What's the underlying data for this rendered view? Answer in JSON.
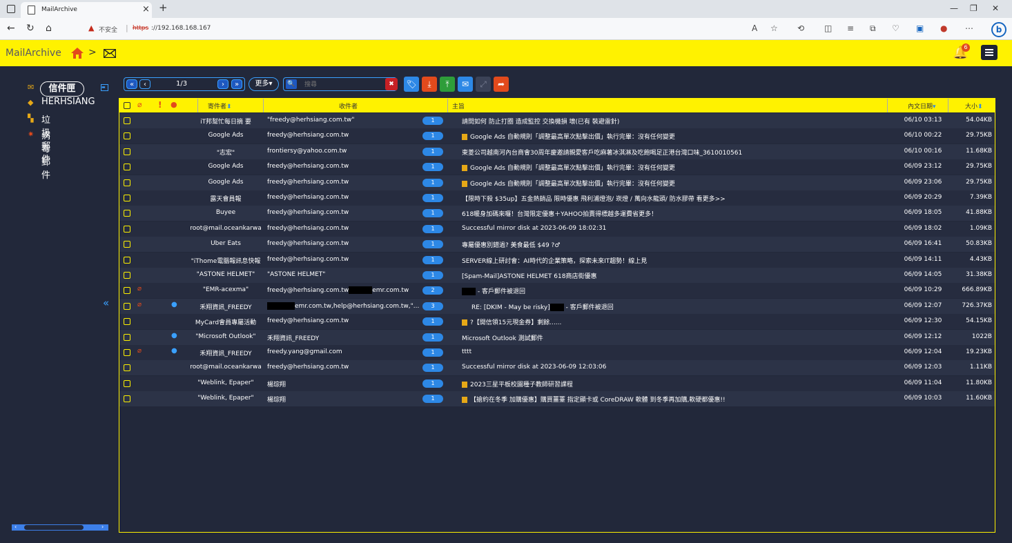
{
  "browser": {
    "tab_title": "MailArchive",
    "insecure_label": "不安全",
    "url_scheme": "https",
    "url_host": "://192.168.168.167"
  },
  "app": {
    "title": "MailArchive",
    "crumb_sep": ">",
    "notification_count": "6"
  },
  "sidebar": {
    "inbox_label": "信件匣",
    "items": [
      {
        "label": "HERHSIANG",
        "icon": "tag-icon"
      },
      {
        "label": "垃圾郵件",
        "icon": "trash-icon"
      },
      {
        "label": "病毒郵件",
        "icon": "virus-icon"
      }
    ]
  },
  "toolbar": {
    "first": "«",
    "prev": "‹",
    "page": "1/3",
    "next": "›",
    "last": "»",
    "more_label": "更多",
    "search_placeholder": "搜尋"
  },
  "grid": {
    "headers": {
      "sender": "寄件者",
      "recipient": "收件者",
      "subject": "主旨",
      "date": "內文日期",
      "size": "大小"
    },
    "rows": [
      {
        "sender": "iT邦幫忙每日摘 要",
        "recipient": "\"freedy@herhsiang.com.tw\"",
        "count": "1",
        "subject": "請問如何 防止打圈 造成監控 交換機損 壞(已有 裝避雷針)",
        "date": "06/10 03:13",
        "size": "54.04KB"
      },
      {
        "sender": "Google Ads",
        "recipient": "freedy@herhsiang.com.tw",
        "count": "1",
        "subject": "Google Ads 自動規則「調整最高單次點擊出價」執行完畢：沒有任何變更",
        "date": "06/10 00:22",
        "size": "29.75KB",
        "icon": true
      },
      {
        "sender": "\"志宏\"",
        "recipient": "frontiersy@yahoo.com.tw",
        "count": "1",
        "subject": "東菱公司越南河內台商會30周年慶邀請親愛客戶吃麻薯冰淇淋及吃飽喝足正港台灣口味_3610010561",
        "date": "06/10 00:16",
        "size": "11.68KB"
      },
      {
        "sender": "Google Ads",
        "recipient": "freedy@herhsiang.com.tw",
        "count": "1",
        "subject": "Google Ads 自動規則「調整最高單次點擊出價」執行完畢：沒有任何變更",
        "date": "06/09 23:12",
        "size": "29.75KB",
        "icon": true
      },
      {
        "sender": "Google Ads",
        "recipient": "freedy@herhsiang.com.tw",
        "count": "1",
        "subject": "Google Ads 自動規則「調整最高單次點擊出價」執行完畢：沒有任何變更",
        "date": "06/09 23:06",
        "size": "29.75KB",
        "icon": true
      },
      {
        "sender": "露天會員報",
        "recipient": "freedy@herhsiang.com.tw",
        "count": "1",
        "subject": "【限時下殺 $35up】五金熱銷品 限時優惠 飛利浦燈泡/ 崁燈 / 萬向水龍頭/ 防水膠帶 看更多>>",
        "date": "06/09 20:29",
        "size": "7.39KB"
      },
      {
        "sender": "Buyee",
        "recipient": "freedy@herhsiang.com.tw",
        "count": "1",
        "subject": "618暖身加碼來囉！台灣限定優惠＋YAHOO拍賣得標越多運費省更多！",
        "date": "06/09 18:05",
        "size": "41.88KB"
      },
      {
        "sender": "root@mail.oceankarwa",
        "recipient": "freedy@herhsiang.com.tw",
        "count": "1",
        "subject": "Successful mirror disk at 2023-06-09 18:02:31",
        "date": "06/09 18:02",
        "size": "1.09KB"
      },
      {
        "sender": "Uber Eats",
        "recipient": "freedy@herhsiang.com.tw",
        "count": "1",
        "subject": "專屬優惠別錯過? 美食最低 $49 ?♂",
        "date": "06/09 16:41",
        "size": "50.83KB"
      },
      {
        "sender": "\"iThome電腦報訊息快報",
        "recipient": "freedy@herhsiang.com.tw",
        "count": "1",
        "subject": "SERVER線上研討會：AI時代的企業策略，探索未來IT趨勢！線上見",
        "date": "06/09 14:11",
        "size": "4.43KB"
      },
      {
        "sender": "\"ASTONE HELMET\"",
        "recipient": "\"ASTONE HELMET\"",
        "count": "1",
        "subject": "[Spam-Mail]ASTONE HELMET  618商店街優惠",
        "date": "06/09 14:05",
        "size": "31.38KB"
      },
      {
        "sender": "\"EMR-acexma\"",
        "recipient": "freedy@herhsiang.com.tw",
        "recipient2": "emr.com.tw",
        "count": "2",
        "subject": " - 客戶郵件被退回",
        "date": "06/09 10:29",
        "size": "666.89KB",
        "clip": true,
        "redact_subject": true
      },
      {
        "sender": "禾翔資訊_FREEDY",
        "recipient": "emr.com.tw,help@herhsiang.com.tw,\"...",
        "count": "3",
        "subject": "RE: [DKIM - May be risky]",
        "subject2": " - 客戶郵件被退回",
        "date": "06/09 12:07",
        "size": "726.37KB",
        "clip": true,
        "person": true
      },
      {
        "sender": "MyCard會員專屬活動",
        "recipient": "freedy@herhsiang.com.tw",
        "count": "1",
        "subject": "?【開信領15元現金券】剩餘......",
        "date": "06/09 12:30",
        "size": "54.15KB",
        "icon": true
      },
      {
        "sender": "\"Microsoft Outlook\"",
        "recipient": "禾翔資訊_FREEDY",
        "count": "1",
        "subject": "Microsoft Outlook 測試郵件",
        "date": "06/09 12:12",
        "size": "1022B",
        "person": true
      },
      {
        "sender": "禾翔資訊_FREEDY",
        "recipient": "freedy.yang@gmail.com",
        "count": "1",
        "subject": "tttt",
        "date": "06/09 12:04",
        "size": "19.23KB",
        "clip": true,
        "person": true
      },
      {
        "sender": "root@mail.oceankarwa",
        "recipient": "freedy@herhsiang.com.tw",
        "count": "1",
        "subject": "Successful mirror disk at 2023-06-09 12:03:06",
        "date": "06/09 12:03",
        "size": "1.11KB"
      },
      {
        "sender": "\"Weblink, Epaper\"",
        "recipient": "楊琮翔",
        "count": "1",
        "subject": "2023三星平板校園種子教師研習課程",
        "date": "06/09 11:04",
        "size": "11.80KB",
        "icon": true
      },
      {
        "sender": "\"Weblink, Epaper\"",
        "recipient": "楊琮翔",
        "count": "1",
        "subject": "【搶約在冬季 加購優惠】購買薑薹 指定顯卡或 CoreDRAW 軟體     到冬季再加購,軟硬都優惠!!",
        "date": "06/09 10:03",
        "size": "11.60KB",
        "icon": true
      }
    ]
  },
  "colors": {
    "accent": "#fff200",
    "bg": "#22283a",
    "blue": "#2d88e6",
    "red": "#e24a1c"
  }
}
